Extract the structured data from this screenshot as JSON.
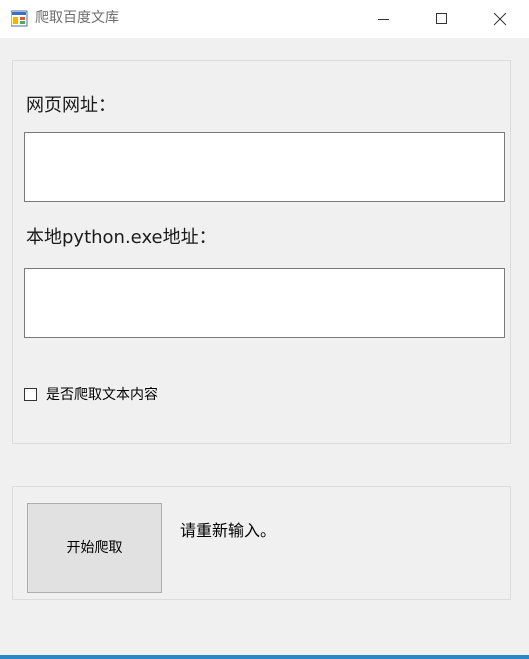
{
  "window": {
    "title": "爬取百度文库",
    "app_icon": "winforms-app-icon",
    "controls": {
      "minimize_icon": "minimize-icon",
      "maximize_icon": "maximize-icon",
      "close_icon": "close-icon"
    }
  },
  "form": {
    "url_label": "网页网址：",
    "url_value": "",
    "python_label": "本地python.exe地址：",
    "python_value": "",
    "crawl_text_checkbox": {
      "label": "是否爬取文本内容",
      "checked": false
    }
  },
  "actions": {
    "start_button_label": "开始爬取",
    "status_message": "请重新输入。"
  },
  "colors": {
    "accent_bottom": "#2b87c6",
    "background": "#f0f0f0"
  }
}
